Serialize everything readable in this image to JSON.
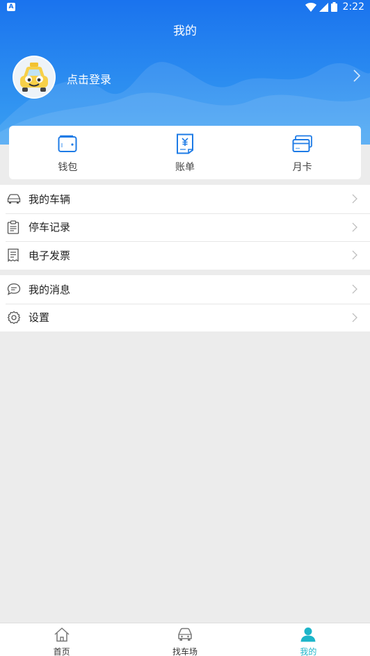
{
  "status_bar": {
    "time": "2:22",
    "left_badge": "A"
  },
  "header": {
    "title": "我的",
    "login_text": "点击登录"
  },
  "quick_actions": [
    {
      "label": "钱包",
      "icon": "wallet-icon"
    },
    {
      "label": "账单",
      "icon": "bill-icon"
    },
    {
      "label": "月卡",
      "icon": "card-icon"
    }
  ],
  "menu_group_1": [
    {
      "label": "我的车辆",
      "icon": "car-icon"
    },
    {
      "label": "停车记录",
      "icon": "clipboard-icon"
    },
    {
      "label": "电子发票",
      "icon": "invoice-icon"
    }
  ],
  "menu_group_2": [
    {
      "label": "我的消息",
      "icon": "message-icon"
    },
    {
      "label": "设置",
      "icon": "gear-icon"
    }
  ],
  "tabs": [
    {
      "label": "首页",
      "icon": "home-icon",
      "active": false
    },
    {
      "label": "找车场",
      "icon": "car-icon",
      "active": false
    },
    {
      "label": "我的",
      "icon": "user-icon",
      "active": true
    }
  ],
  "colors": {
    "header_blue": "#1a73ee",
    "accent_teal": "#1cb5c9",
    "icon_blue": "#1e7be6"
  }
}
